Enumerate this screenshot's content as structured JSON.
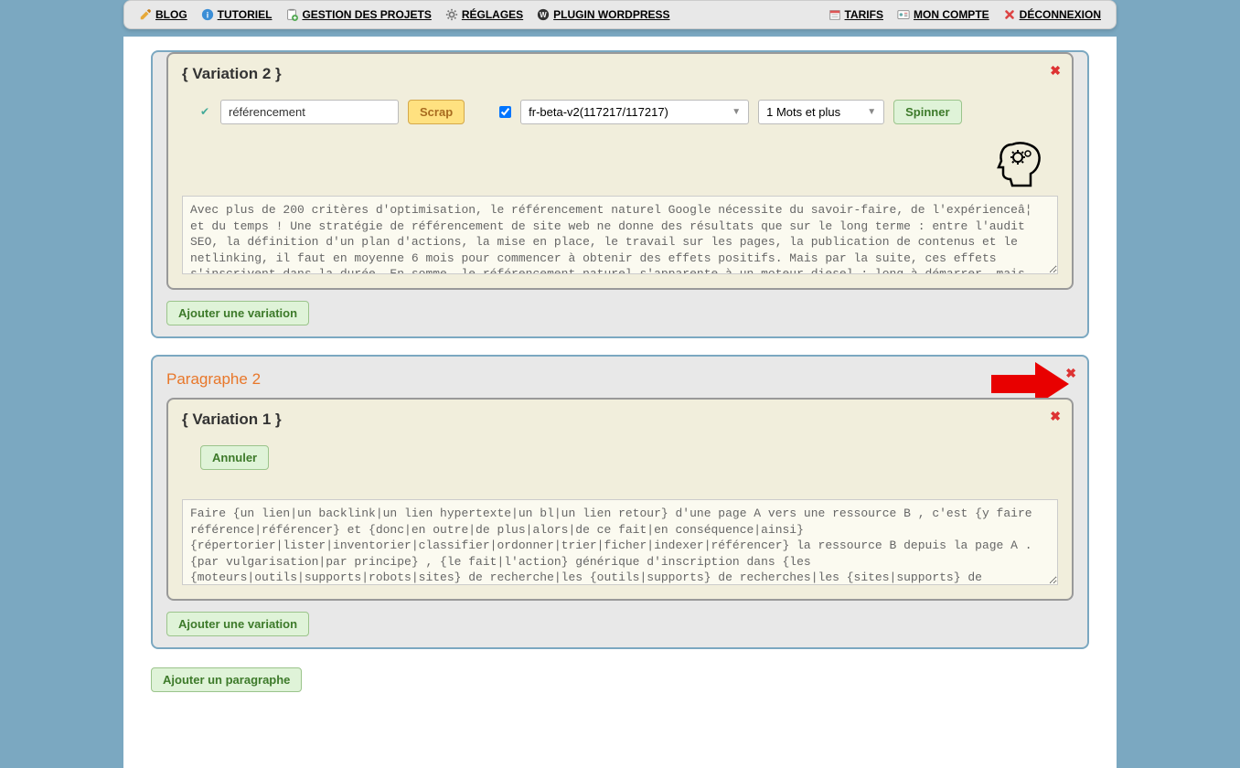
{
  "nav": {
    "left": {
      "blog": "BLOG",
      "tutoriel": "TUTORIEL",
      "projets": "GESTION DES PROJETS",
      "reglages": "RÉGLAGES",
      "wordpress": "PLUGIN WORDPRESS"
    },
    "right": {
      "tarifs": "TARIFS",
      "compte": "MON COMPTE",
      "deconnexion": "DÉCONNEXION"
    }
  },
  "variation2": {
    "title": "{ Variation 2 }",
    "keyword": "référencement",
    "scrap": "Scrap",
    "lang": "fr-beta-v2(117217/117217)",
    "words": "1 Mots et plus",
    "spinner": "Spinner",
    "text": "Avec plus de 200 critères d'optimisation, le référencement naturel Google nécessite du savoir-faire, de l'expérienceâ¦ et du temps ! Une stratégie de référencement de site web ne donne des résultats que sur le long terme : entre l'audit SEO, la définition d'un plan d'actions, la mise en place, le travail sur les pages, la publication de contenus et le netlinking, il faut en moyenne 6 mois pour commencer à obtenir des effets positifs. Mais par la suite, ces effets s'inscrivent dans la durée. En somme, le référencement naturel s'apparente à un moteur diesel : long à démarrer, mais efficace sur la durée !",
    "addVariation": "Ajouter une variation"
  },
  "paragraphe2": {
    "title": "Paragraphe 2",
    "variation1": {
      "title": "{ Variation 1 }",
      "annuler": "Annuler",
      "text": "Faire {un lien|un backlink|un lien hypertexte|un bl|un lien retour} d'une page A vers une ressource B , c'est {y faire référence|référencer} et {donc|en outre|de plus|alors|de ce fait|en conséquence|ainsi} {répertorier|lister|inventorier|classifier|ordonner|trier|ficher|indexer|référencer} la ressource B depuis la page A . {par vulgarisation|par principe} , {le fait|l'action} générique d'inscription dans {les {moteurs|outils|supports|robots|sites} de recherche|les {outils|supports} de recherches|les {sites|supports} de recherches} {a été|est} {qualifiée|baptisée|appelée|désignée|dénommée|prénommée|surnommée} référencement . {aujourd'hui|à présent|maintenant} , sa"
    },
    "addVariation": "Ajouter une variation"
  },
  "addParagraph": "Ajouter un paragraphe"
}
